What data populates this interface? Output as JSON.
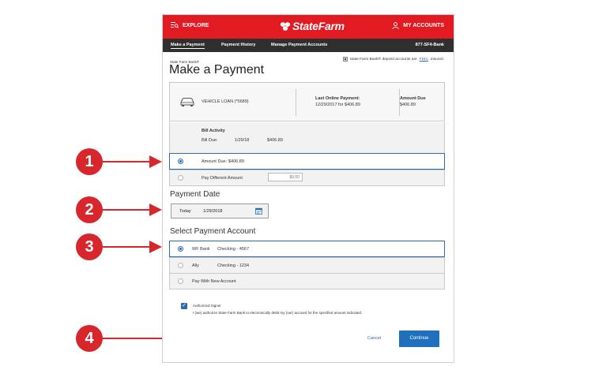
{
  "header": {
    "explore_label": "EXPLORE",
    "brand": "StateFarm",
    "accounts_label": "MY ACCOUNTS",
    "brand_color": "#e21a22"
  },
  "subnav": {
    "items": [
      "Make a Payment",
      "Payment History",
      "Manage Payment Accounts"
    ],
    "phone": "877-SF4-Bank"
  },
  "bank_label": "State Farm Bank®",
  "fdic": {
    "prefix": "State Farm Bank® deposit accounts are",
    "link": "FDIC",
    "suffix": "insured."
  },
  "page_title": "Make a Payment",
  "loan": {
    "name": "VEHICLE LOAN (*5689)",
    "last_payment_label": "Last Online Payment:",
    "last_payment_value": "12/29/2017 for $406.89",
    "amount_due_label": "Amount Due",
    "amount_due_value": "$406.89"
  },
  "bill": {
    "title": "Bill Activity",
    "due_label": "Bill Due:",
    "due_date": "1/29/18",
    "due_amount": "$406.89"
  },
  "amount_options": [
    {
      "label": "Amount Due:",
      "value": "$406.89"
    },
    {
      "label": "Pay Different Amount",
      "placeholder": "$0.00"
    }
  ],
  "payment_date": {
    "section_title": "Payment Date",
    "prefix": "Today",
    "date": "1/29/2018"
  },
  "payment_account": {
    "section_title": "Select Payment Account",
    "options": [
      {
        "bank": "WF Bank",
        "account": "Checking - 4567"
      },
      {
        "bank": "Ally",
        "account": "Checking - 1234"
      },
      {
        "bank": "Pay With New Account",
        "account": ""
      }
    ]
  },
  "authorized": {
    "label": "Authorized Signer",
    "text": "I (we) authorize State Farm Bank to electronically debit my (our) account for the specified amount indicated."
  },
  "actions": {
    "cancel": "Cancel",
    "continue": "Continue"
  },
  "callouts": [
    "1",
    "2",
    "3",
    "4"
  ],
  "colors": {
    "accent": "#2a6cb2",
    "callout": "#d7262c"
  }
}
